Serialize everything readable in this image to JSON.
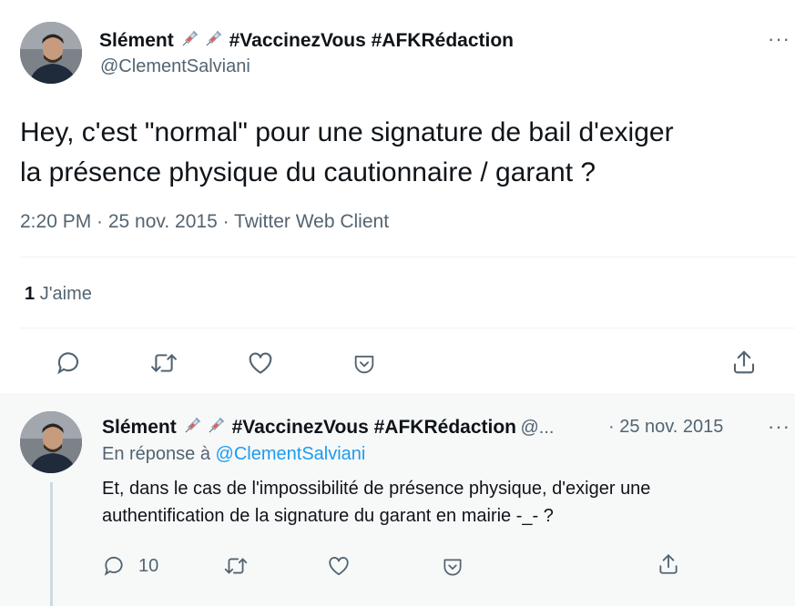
{
  "main_tweet": {
    "display_name": "Slément",
    "hashtags": "#VaccinezVous #AFKRédaction",
    "handle": "@ClementSalviani",
    "text_line1": "Hey, c'est \"normal\" pour une signature de bail d'exiger",
    "text_line2": "la présence physique du cautionnaire / garant ?",
    "meta": "2:20 PM · 25 nov. 2015 · Twitter Web Client",
    "likes_count": "1",
    "likes_label": "J'aime",
    "more": "···"
  },
  "reply_tweet": {
    "display_name": "Slément",
    "hashtags": "#VaccinezVous #AFKRédaction",
    "handle_truncated": "@...",
    "date": "· 25 nov. 2015",
    "in_reply_prefix": "En réponse à",
    "in_reply_handle": "@ClementSalviani",
    "text_line1": "Et, dans le cas de l'impossibilité de présence physique, d'exiger une",
    "text_line2": "authentification de la signature du garant en mairie -_- ?",
    "reply_count": "10",
    "more": "···"
  },
  "icons": [
    "reply-icon",
    "retweet-icon",
    "like-icon",
    "downvote-icon",
    "share-icon",
    "syringe-icon",
    "more-icon"
  ],
  "colors": {
    "text": "#0f1419",
    "muted": "#536471",
    "link": "#1d9bf0",
    "divider": "#eff3f4",
    "reply_bg": "#f7f9f9"
  }
}
